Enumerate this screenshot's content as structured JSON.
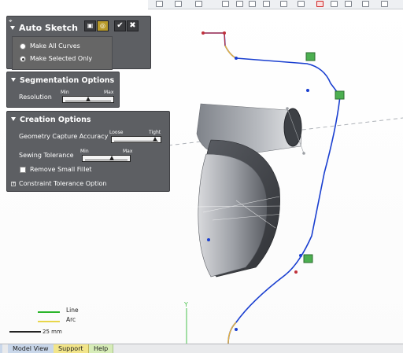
{
  "app": {
    "title": "Auto Sketch"
  },
  "auto_sketch": {
    "title": "Auto Sketch",
    "options": [
      {
        "label": "Make All Curves",
        "selected": false
      },
      {
        "label": "Make Selected Only",
        "selected": true
      }
    ]
  },
  "segmentation": {
    "title": "Segmentation Options",
    "resolution_label": "Resolution",
    "min": "Min",
    "max": "Max",
    "value": 0.5
  },
  "creation": {
    "title": "Creation Options",
    "accuracy_label": "Geometry Capture Accuracy",
    "loose": "Loose",
    "tight": "Tight",
    "accuracy_value": 0.9,
    "sewing_label": "Sewing Tolerance",
    "min": "Min",
    "max": "Max",
    "sewing_value": 0.6,
    "remove_fillet_label": "Remove Small Fillet",
    "remove_fillet_checked": false,
    "constraint_label": "Constraint Tolerance Option"
  },
  "legend": {
    "line": "Line",
    "arc": "Arc",
    "line_color": "#2ab52a",
    "arc_color": "#e8d64a"
  },
  "scale": {
    "label": "25 mm"
  },
  "axis": {
    "label": "Y"
  },
  "tabs": [
    {
      "label": "Model View",
      "color": "#c9d7ea"
    },
    {
      "label": "Support",
      "color": "#f2e58a"
    },
    {
      "label": "Help",
      "color": "#d6ecb8"
    }
  ],
  "colors": {
    "panel_bg": "#5d5f63",
    "curve": "#1a3fd0",
    "sketch_marker": "#4caf50",
    "highlight_red": "#e03a3a"
  }
}
